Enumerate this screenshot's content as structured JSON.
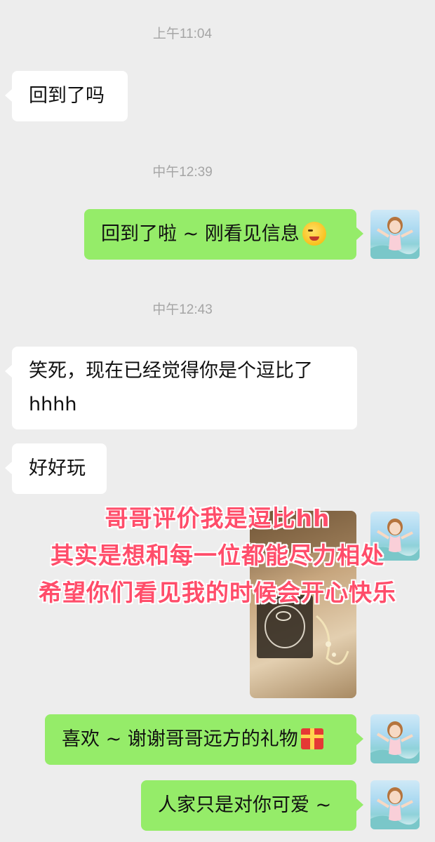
{
  "timestamps": [
    "上午11:04",
    "中午12:39",
    "中午12:43"
  ],
  "messages": [
    {
      "text": "回到了吗"
    },
    {
      "text": "回到了啦 ~ 刚看见信息"
    },
    {
      "line1": "笑死，现在已经觉得你是个逗比了",
      "line2": "hhhh"
    },
    {
      "text": "好好玩"
    },
    {
      "text": "喜欢 ~ 谢谢哥哥远方的礼物"
    },
    {
      "text": "人家只是对你可爱 ~"
    }
  ],
  "overlay": [
    "哥哥评价我是逗比hh",
    "其实是想和每一位都能尽力相处",
    "希望你们看见我的时候会开心快乐"
  ],
  "colors": {
    "background": "#ededed",
    "sent_bubble": "#95ec69",
    "received_bubble": "#ffffff",
    "overlay_text": "#ff4d6a"
  },
  "icons": [
    "winking-face-emoji",
    "gift-emoji"
  ]
}
